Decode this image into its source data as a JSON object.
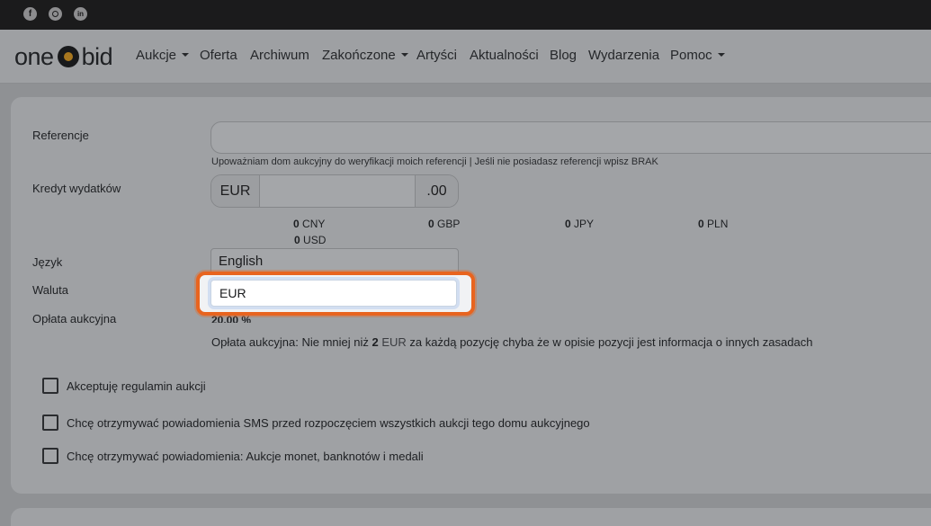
{
  "social": {
    "facebook_glyph": "f",
    "linkedin_glyph": "in"
  },
  "nav": {
    "logo_left": "one",
    "logo_right": "bid",
    "items": [
      {
        "label": "Aukcje",
        "dropdown": true
      },
      {
        "label": "Oferta",
        "dropdown": false
      },
      {
        "label": "Archiwum",
        "dropdown": false
      },
      {
        "label": "Zakończone",
        "dropdown": true
      },
      {
        "label": "Artyści",
        "dropdown": false
      },
      {
        "label": "Aktualności",
        "dropdown": false
      },
      {
        "label": "Blog",
        "dropdown": false
      },
      {
        "label": "Wydarzenia",
        "dropdown": false
      },
      {
        "label": "Pomoc",
        "dropdown": true
      }
    ]
  },
  "form": {
    "references": {
      "label": "Referencje",
      "value": "",
      "hint": "Upoważniam dom aukcyjny do weryfikacji moich referencji | Jeśli nie posiadasz referencji wpisz BRAK"
    },
    "credit": {
      "label": "Kredyt wydatków",
      "prefix": "EUR",
      "value": "",
      "suffix": ".00",
      "conversions": [
        {
          "amount": "0",
          "currency": "CNY"
        },
        {
          "amount": "0",
          "currency": "GBP"
        },
        {
          "amount": "0",
          "currency": "JPY"
        },
        {
          "amount": "0",
          "currency": "PLN"
        },
        {
          "amount": "0",
          "currency": "USD"
        }
      ]
    },
    "language": {
      "label": "Język",
      "value": "English"
    },
    "currency": {
      "label": "Waluta",
      "value": "EUR"
    },
    "fee": {
      "label": "Opłata aukcyjna",
      "value": "20.00 %",
      "note_prefix": "Opłata aukcyjna: Nie mniej niż",
      "note_amount": "2",
      "note_currency": "EUR",
      "note_suffix": "za każdą pozycję chyba że w opisie pozycji jest informacja o innych zasadach"
    },
    "checkboxes": [
      {
        "label": "Akceptuję regulamin aukcji",
        "checked": false
      },
      {
        "label": "Chcę otrzymywać powiadomienia SMS przed rozpoczęciem wszystkich aukcji tego domu aukcyjnego",
        "checked": false
      },
      {
        "label": "Chcę otrzymywać powiadomienia: Aukcje monet, banknotów i medali",
        "checked": false
      }
    ]
  },
  "colors": {
    "highlight": "#e8641f",
    "topbar": "#1b1b1c"
  }
}
